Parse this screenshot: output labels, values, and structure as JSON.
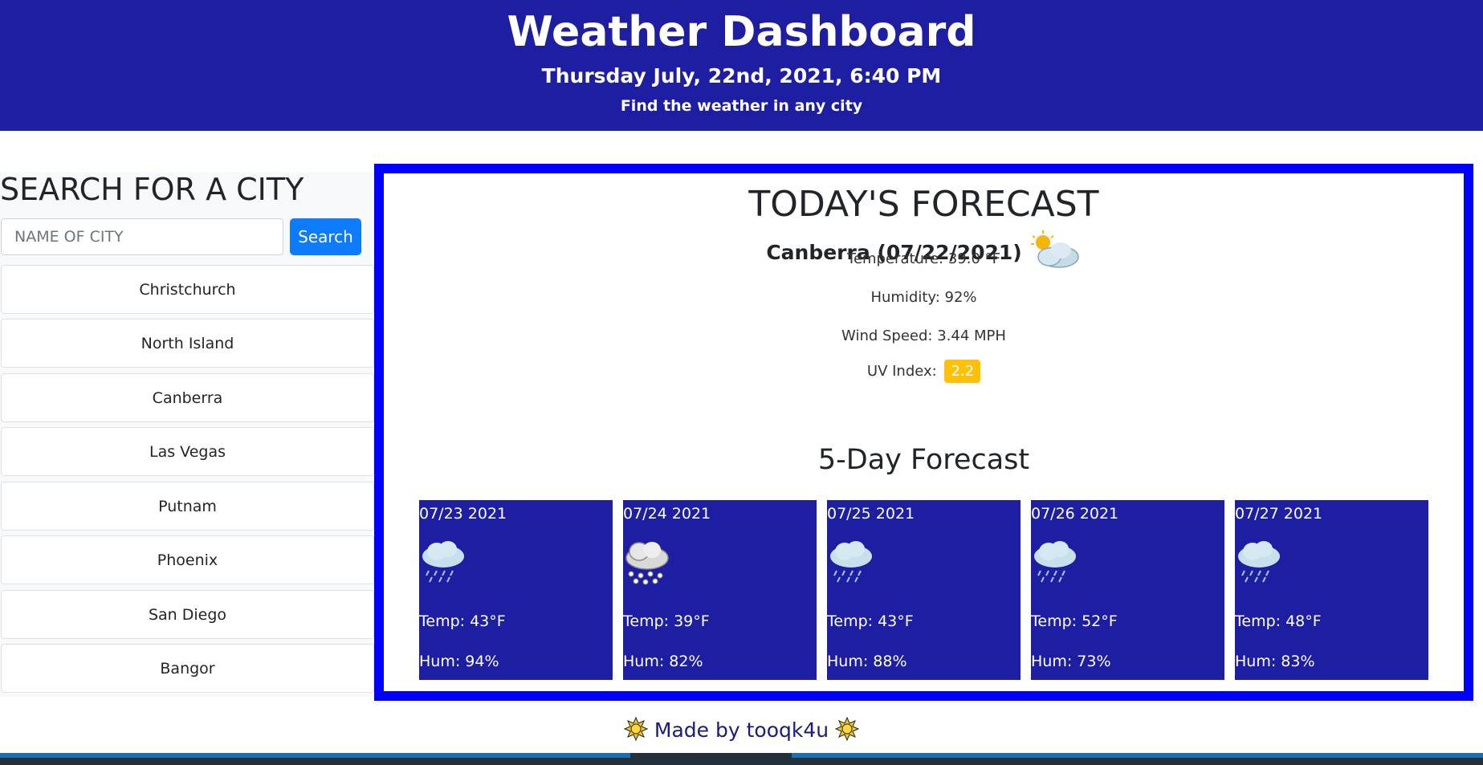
{
  "header": {
    "title": "Weather Dashboard",
    "datetime": "Thursday July, 22nd, 2021, 6:40 PM",
    "subtitle": "Find the weather in any city"
  },
  "sidebar": {
    "heading": "SEARCH FOR A CITY",
    "search_placeholder": "NAME OF CITY",
    "search_button": "Search",
    "cities": [
      "Christchurch",
      "North Island",
      "Canberra",
      "Las Vegas",
      "Putnam",
      "Phoenix",
      "San Diego",
      "Bangor"
    ]
  },
  "today": {
    "heading": "TODAY'S FORECAST",
    "city_date": "Canberra (07/22/2021)",
    "icon": "partly-cloudy-icon",
    "temperature": "Temperature: 39.0 °F",
    "humidity": "Humidity: 92%",
    "wind": "Wind Speed: 3.44 MPH",
    "uv_label": "UV Index:",
    "uv_value": "2.2",
    "uv_color": "#ffc107"
  },
  "forecast": {
    "heading": "5-Day Forecast",
    "days": [
      {
        "date": "07/23 2021",
        "icon": "rain-icon",
        "temp": "Temp: 43°F",
        "hum": "Hum: 94%"
      },
      {
        "date": "07/24 2021",
        "icon": "snow-icon",
        "temp": "Temp: 39°F",
        "hum": "Hum: 82%"
      },
      {
        "date": "07/25 2021",
        "icon": "rain-icon",
        "temp": "Temp: 43°F",
        "hum": "Hum: 88%"
      },
      {
        "date": "07/26 2021",
        "icon": "rain-icon",
        "temp": "Temp: 52°F",
        "hum": "Hum: 73%"
      },
      {
        "date": "07/27 2021",
        "icon": "rain-icon",
        "temp": "Temp: 48°F",
        "hum": "Hum: 83%"
      }
    ]
  },
  "footer": {
    "text": "Made by tooqk4u",
    "icon": "sun-emoji-icon"
  },
  "colors": {
    "header_bg": "#1e1ea3",
    "border": "#0000ff",
    "button": "#0d7bfd"
  }
}
